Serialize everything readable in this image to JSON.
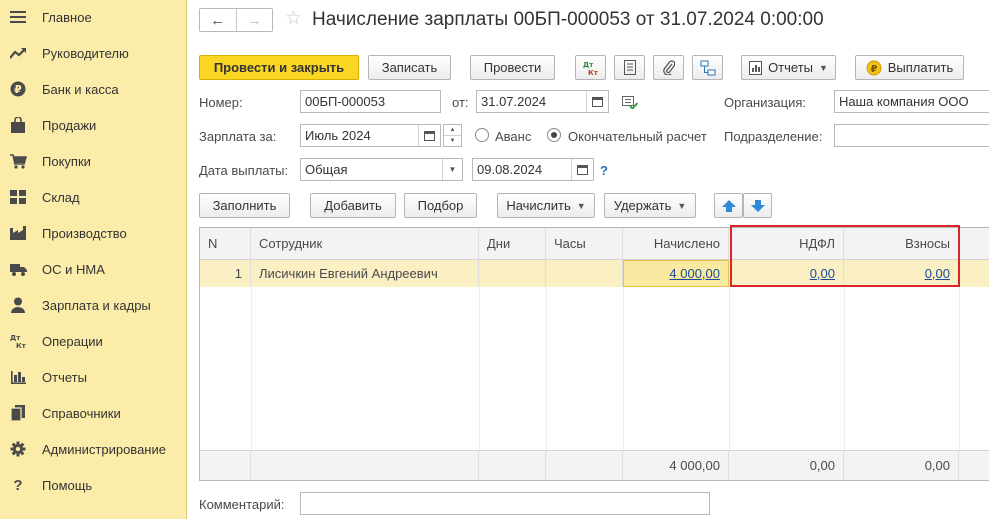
{
  "sidebar": {
    "items": [
      {
        "label": "Главное",
        "icon": "menu-icon"
      },
      {
        "label": "Руководителю",
        "icon": "trend-icon"
      },
      {
        "label": "Банк и касса",
        "icon": "ruble-icon"
      },
      {
        "label": "Продажи",
        "icon": "bag-icon"
      },
      {
        "label": "Покупки",
        "icon": "cart-icon"
      },
      {
        "label": "Склад",
        "icon": "warehouse-icon"
      },
      {
        "label": "Производство",
        "icon": "factory-icon"
      },
      {
        "label": "ОС и НМА",
        "icon": "truck-icon"
      },
      {
        "label": "Зарплата и кадры",
        "icon": "person-icon"
      },
      {
        "label": "Операции",
        "icon": "dt-kt-icon"
      },
      {
        "label": "Отчеты",
        "icon": "bar-chart-icon"
      },
      {
        "label": "Справочники",
        "icon": "books-icon"
      },
      {
        "label": "Администрирование",
        "icon": "gear-icon"
      },
      {
        "label": "Помощь",
        "icon": "question-icon"
      }
    ]
  },
  "header": {
    "back": "←",
    "forward": "→",
    "star": "☆",
    "title": "Начисление зарплаты 00БП-000053 от 31.07.2024 0:00:00"
  },
  "toolbar": {
    "post_close": "Провести и закрыть",
    "save": "Записать",
    "post": "Провести",
    "reports": "Отчеты",
    "pay": "Выплатить"
  },
  "form": {
    "number_label": "Номер:",
    "number": "00БП-000053",
    "date_label": "от:",
    "date": "31.07.2024",
    "org_label": "Организация:",
    "org": "Наша компания ООО",
    "salary_for_label": "Зарплата за:",
    "salary_for": "Июль 2024",
    "advance_label": "Аванс",
    "final_label": "Окончательный расчет",
    "dept_label": "Подразделение:",
    "dept": "",
    "pay_date_label": "Дата выплаты:",
    "pay_type": "Общая",
    "pay_date": "09.08.2024",
    "help": "?"
  },
  "actions": {
    "fill": "Заполнить",
    "add": "Добавить",
    "pick": "Подбор",
    "accrue": "Начислить",
    "withhold": "Удержать"
  },
  "table": {
    "columns": [
      "N",
      "Сотрудник",
      "Дни",
      "Часы",
      "Начислено",
      "НДФЛ",
      "Взносы"
    ],
    "rows": [
      {
        "n": "1",
        "employee": "Лисичкин Евгений Андреевич",
        "days": "",
        "hours": "",
        "accrued": "4 000,00",
        "ndfl": "0,00",
        "contrib": "0,00"
      }
    ],
    "totals": {
      "accrued": "4 000,00",
      "ndfl": "0,00",
      "contrib": "0,00"
    }
  },
  "comment_label": "Комментарий:",
  "comment": ""
}
